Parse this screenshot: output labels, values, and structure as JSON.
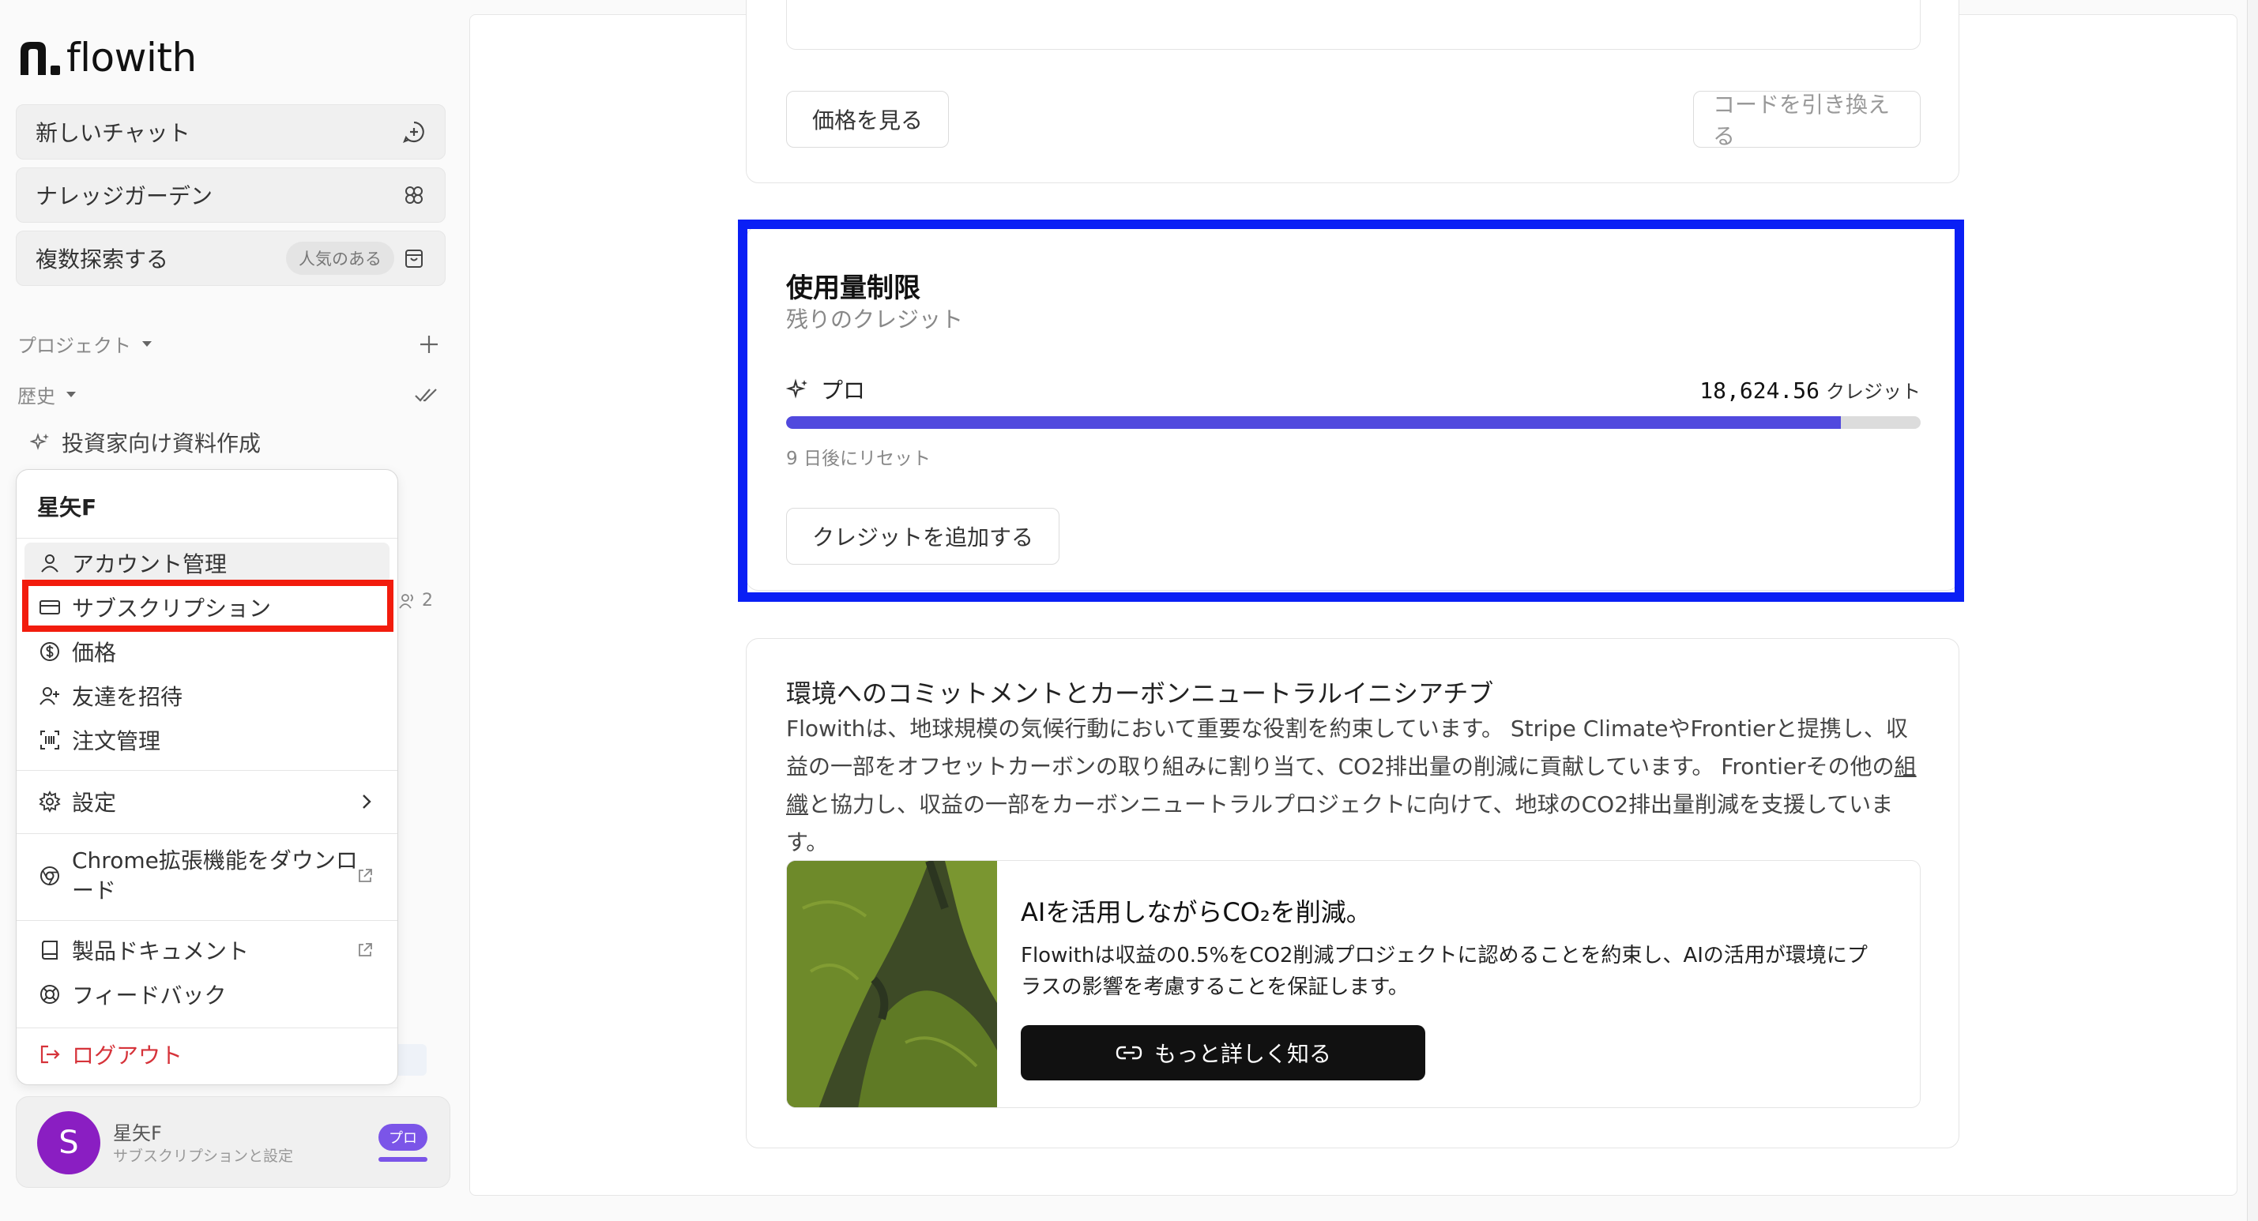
{
  "app": {
    "name": "flowith"
  },
  "sidebar": {
    "new_chat": "新しいチャット",
    "knowledge_garden": "ナレッジガーデン",
    "multi_explore": "複数探索する",
    "popular_badge": "人気のある",
    "projects_label": "プロジェクト",
    "history_label": "歴史",
    "history_items": [
      {
        "label": "投資家向け資料作成"
      }
    ],
    "member_count": "2"
  },
  "account_menu": {
    "user_name": "星矢F",
    "items": {
      "account": "アカウント管理",
      "subscription": "サブスクリプション",
      "pricing": "価格",
      "invite": "友達を招待",
      "orders": "注文管理",
      "settings": "設定",
      "chrome_ext": "Chrome拡張機能をダウンロード",
      "docs": "製品ドキュメント",
      "feedback": "フィードバック",
      "logout": "ログアウト"
    }
  },
  "user_card": {
    "avatar_letter": "S",
    "name": "星矢F",
    "subtitle": "サブスクリプションと設定",
    "plan_badge": "プロ"
  },
  "billing": {
    "view_pricing": "価格を見る",
    "redeem_placeholder": "コードを引き換える"
  },
  "usage": {
    "title": "使用量制限",
    "subtitle": "残りのクレジット",
    "plan_name": "プロ",
    "credits_value": "18,624.56",
    "credits_unit": "クレジット",
    "remaining_fraction": 0.93,
    "reset_text": "9 日後にリセット",
    "add_credits": "クレジットを追加する"
  },
  "environment": {
    "title": "環境へのコミットメントとカーボンニュートラルイニシアチブ",
    "body_1": "Flowithは、地球規模の気候行動において重要な役割を約束しています。 Stripe ClimateやFrontierと提携し、収益の一部をオフセットカーボンの取り組みに割り当て、CO2排出量の削減に貢献しています。 Frontierその他の",
    "body_link": "組織",
    "body_2": "と協力し、収益の一部をカーボンニュートラルプロジェクトに向けて、地球のCO2排出量削減を支援しています。",
    "promo_title": "AIを活用しながらCO₂を削減。",
    "promo_body": "Flowithは収益の0.5%をCO2削減プロジェクトに認めることを約束し、AIの活用が環境にプラスの影響を考慮することを保証します。",
    "learn_more": "もっと詳しく知る"
  },
  "colors": {
    "accent_purple": "#5149de",
    "badge_purple": "#7b55e8",
    "avatar": "#8a1ec2",
    "highlight_blue": "#0a1ff5",
    "highlight_red": "#f21c0d",
    "logout_red": "#d6333a"
  }
}
